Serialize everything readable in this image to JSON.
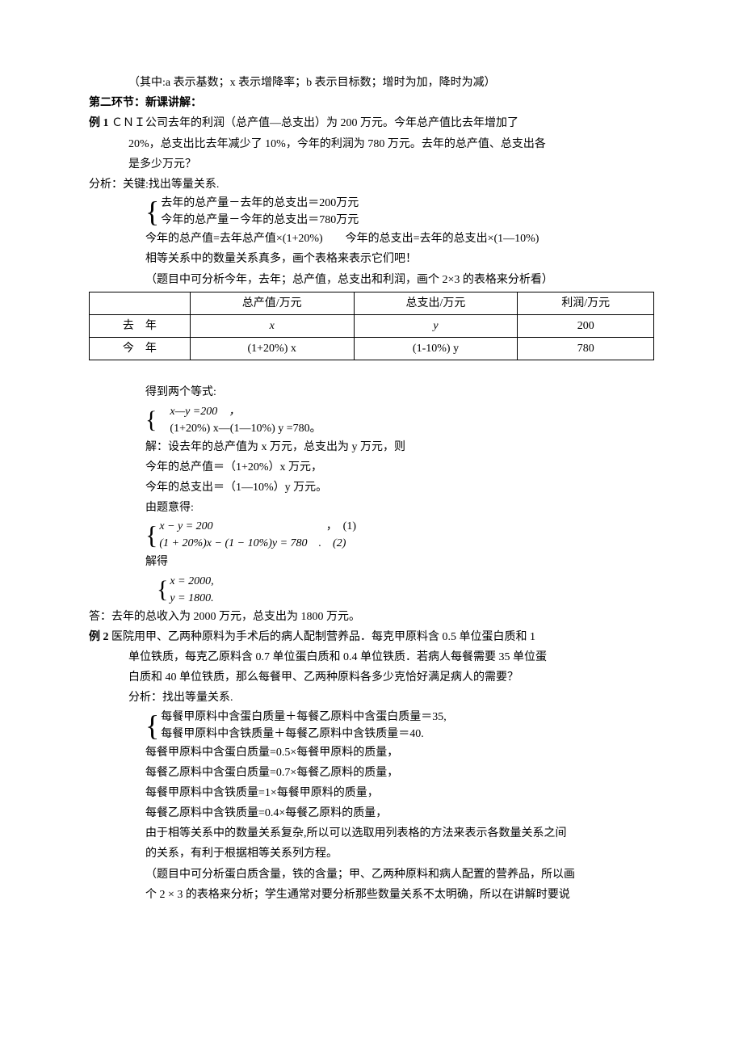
{
  "intro_note": "（其中:a 表示基数；x 表示增降率；b 表示目标数；增时为加，降时为减）",
  "section2_header": "第二环节：新课讲解：",
  "ex1": {
    "label": "例 1",
    "q_line1": "ＣＮＩ公司去年的利润（总产值—总支出）为 200 万元。今年总产值比去年增加了",
    "q_line2": "20%，总支出比去年减少了 10%，今年的利润为 780 万元。去年的总产值、总支出各",
    "q_line3": "是多少万元？",
    "analysis": "分析：关键:找出等量关系.",
    "brace_a": "去年的总产量－去年的总支出＝200万元",
    "brace_b": "今年的总产量－今年的总支出＝780万元",
    "rel1": "今年的总产值=去年总产值×(1+20%)　　今年的总支出=去年的总支出×(1—10%)",
    "rel2": "相等关系中的数量关系真多，画个表格来表示它们吧！",
    "rel3": "（题目中可分析今年，去年；总产值，总支出和利润，画个 2×3 的表格来分析看）",
    "table": {
      "h1": "",
      "h2": "总产值/万元",
      "h3": "总支出/万元",
      "h4": "利润/万元",
      "r1c1": "去　年",
      "r1c2": "x",
      "r1c3": "y",
      "r1c4": "200",
      "r2c1": "今　年",
      "r2c2": "(1+20%) x",
      "r2c3": "(1-10%) y",
      "r2c4": "780"
    },
    "deduce": "得到两个等式:",
    "eq1": "x—y =200　，",
    "eq2": "(1+20%) x—(1—10%) y =780。",
    "sol_set": "解：设去年的总产值为 x 万元，总支出为 y 万元，则",
    "sol_a": "今年的总产值＝（1+20%）x 万元，",
    "sol_b": "今年的总支出＝（1—10%）y 万元。",
    "sol_c": "由题意得:",
    "sys1": "x − y = 200",
    "sys1_tail": "，　(1)",
    "sys2": "(1 + 20%)x − (1 − 10%)y = 780　.　(2)",
    "solve_word": "解得",
    "res1": "x = 2000,",
    "res2": "y = 1800.",
    "answer": "答：去年的总收入为 2000 万元，总支出为 1800 万元。"
  },
  "ex2": {
    "label": "例 2",
    "q1": "医院用甲、乙两种原料为手术后的病人配制营养品．每克甲原料含 0.5 单位蛋白质和 1",
    "q2": "单位铁质，每克乙原料含 0.7 单位蛋白质和 0.4 单位铁质．若病人每餐需要 35 单位蛋",
    "q3": "白质和 40 单位铁质，那么每餐甲、乙两种原料各多少克恰好满足病人的需要？",
    "analysis": "分析：找出等量关系.",
    "brace_a": "每餐甲原料中含蛋白质量＋每餐乙原料中含蛋白质量＝35,",
    "brace_b": "每餐甲原料中含铁质量＋每餐乙原料中含铁质量＝40.",
    "l1": "每餐甲原料中含蛋白质量=0.5×每餐甲原料的质量，",
    "l2": "每餐乙原料中含蛋白质量=0.7×每餐乙原料的质量，",
    "l3": "每餐甲原料中含铁质量=1×每餐甲原料的质量，",
    "l4": "每餐乙原料中含铁质量=0.4×每餐乙原料的质量，",
    "l5": "由于相等关系中的数量关系复杂,所以可以选取用列表格的方法来表示各数量关系之间",
    "l6": "的关系，有利于根据相等关系列方程。",
    "l7": "（题目中可分析蛋白质含量，铁的含量；甲、乙两种原料和病人配置的营养品，所以画",
    "l8": "个 2 × 3 的表格来分析；学生通常对要分析那些数量关系不太明确，所以在讲解时要说"
  }
}
